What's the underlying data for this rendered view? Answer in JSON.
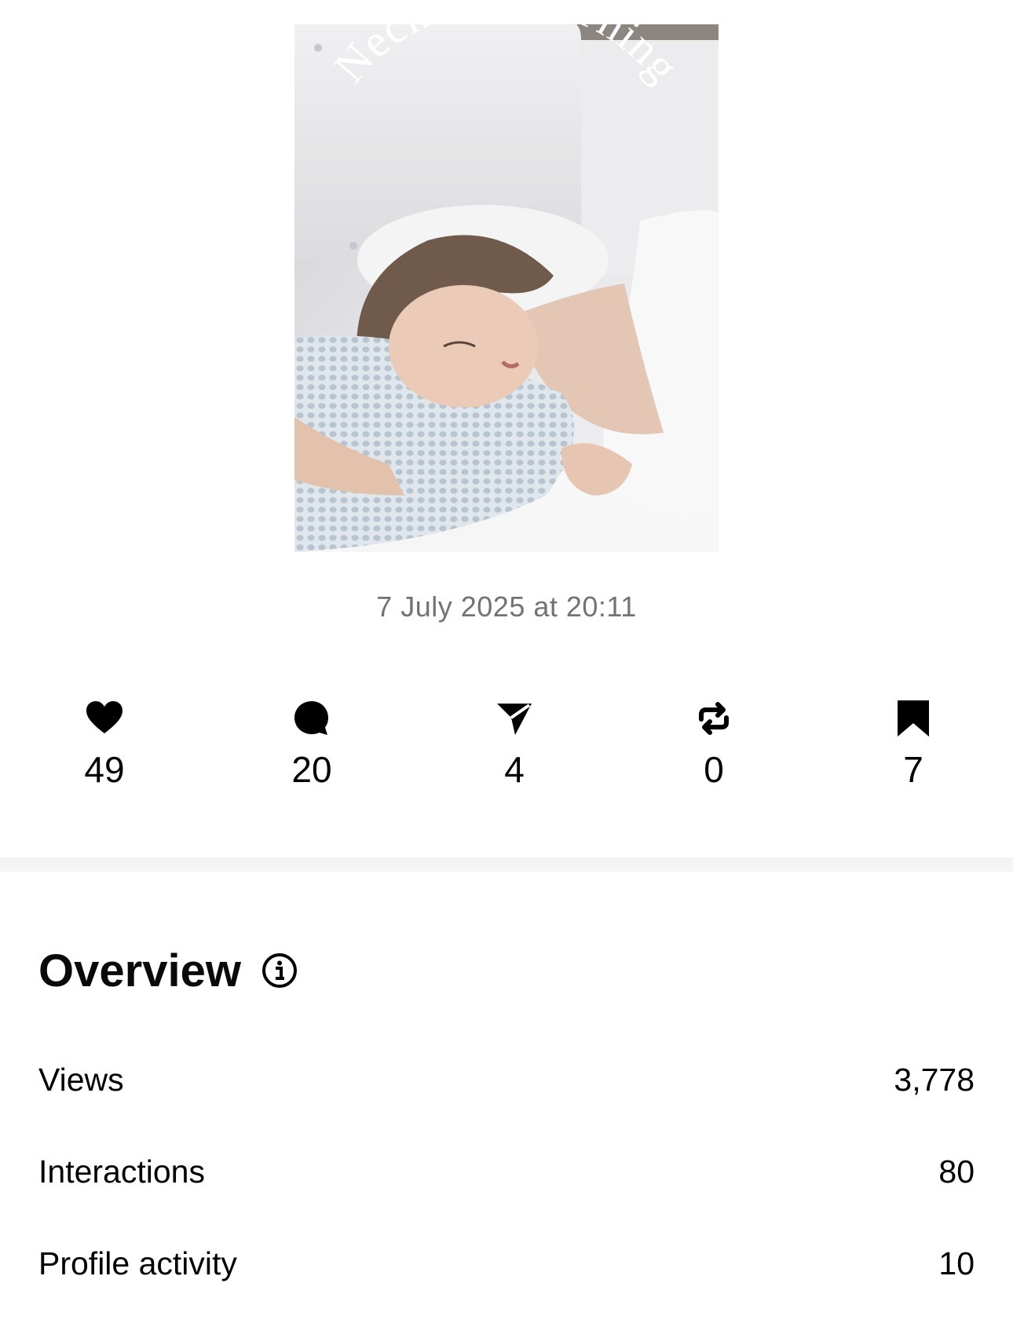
{
  "post": {
    "image_title": "Neck’s Best Thing",
    "date": "7 July 2025 at 20:11"
  },
  "metrics": [
    {
      "name": "likes",
      "icon": "heart-icon",
      "count": "49"
    },
    {
      "name": "comments",
      "icon": "comment-bubble-icon",
      "count": "20"
    },
    {
      "name": "shares",
      "icon": "paper-plane-icon",
      "count": "4"
    },
    {
      "name": "reposts",
      "icon": "repost-icon",
      "count": "0"
    },
    {
      "name": "saves",
      "icon": "bookmark-icon",
      "count": "7"
    }
  ],
  "overview": {
    "title": "Overview",
    "info_icon": "info-icon",
    "rows": [
      {
        "label": "Views",
        "value": "3,778"
      },
      {
        "label": "Interactions",
        "value": "80"
      },
      {
        "label": "Profile activity",
        "value": "10"
      }
    ]
  }
}
